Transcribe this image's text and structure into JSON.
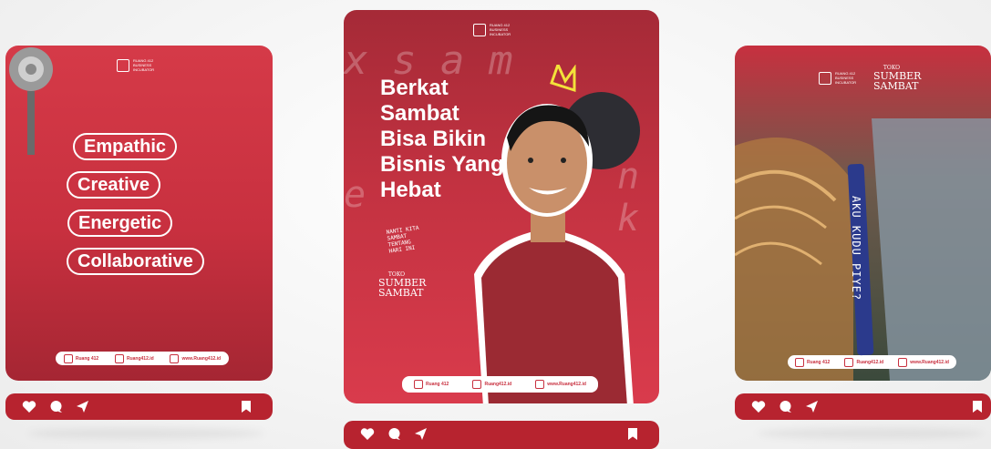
{
  "posts": [
    {
      "logo_text": "RUANG 412 BUSINESS INCUBATOR",
      "values": [
        "Empathic",
        "Creative",
        "Energetic",
        "Collaborative"
      ],
      "footer": {
        "linkedin": "Ruang 412",
        "instagram": "Ruang412.id",
        "website": "www.Ruang412.id"
      }
    },
    {
      "logo_text": "RUANG 412 BUSINESS INCUBATOR",
      "headline": "Berkat\nSambat\nBisa Bikin\nBisnis Yang\nHebat",
      "tagline": "NANTI KITA SAMBAT TENTANG HARI INI",
      "brand_top": "TOKO",
      "brand_main": "SUMBER SAMBAT",
      "footer": {
        "linkedin": "Ruang 412",
        "instagram": "Ruang412.id",
        "website": "www.Ruang412.id"
      }
    },
    {
      "logo_text": "RUANG 412 BUSINESS INCUBATOR",
      "brand_top": "TOKO",
      "brand_main": "SUMBER SAMBAT",
      "lanyard_text": "AKU KUDU PIYE?",
      "footer": {
        "linkedin": "Ruang 412",
        "instagram": "Ruang412.id",
        "website": "www.Ruang412.id"
      }
    }
  ],
  "icons": {
    "like": "heart-icon",
    "comment": "comment-icon",
    "share": "send-icon",
    "save": "bookmark-icon"
  },
  "colors": {
    "accent": "#c8303f",
    "action_bar": "#b7232f"
  }
}
